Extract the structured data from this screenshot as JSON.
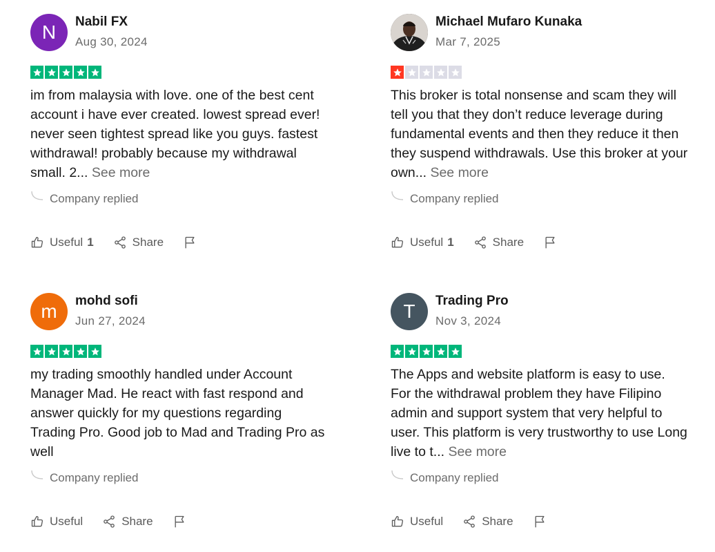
{
  "colors": {
    "star_filled": "#00b67a",
    "star_low": "#ff3722",
    "star_empty": "#dcdce6"
  },
  "actions": {
    "useful_label": "Useful",
    "share_label": "Share"
  },
  "reviews": [
    {
      "reviewer": "Nabil FX",
      "avatar_initial": "N",
      "avatar_color": "#7b25b6",
      "date": "Aug 30, 2024",
      "rating": 5,
      "text": "im from malaysia with love. one of the best cent account i have ever created. lowest spread ever! never seen tightest spread like you guys. fastest withdrawal! probably because my withdrawal small. 2...",
      "see_more": "See more",
      "company_replied": "Company replied",
      "useful_count": "1"
    },
    {
      "reviewer": "Michael Mufaro Kunaka",
      "avatar_initial": "",
      "avatar_color": "#3b3b3b",
      "date": "Mar 7, 2025",
      "rating": 1,
      "text": "This broker is total nonsense and scam they will tell you that they don’t reduce leverage during fundamental events and then they reduce it then they suspend withdrawals. Use this broker at your own...",
      "see_more": "See more",
      "company_replied": "Company replied",
      "useful_count": "1"
    },
    {
      "reviewer": "mohd sofi",
      "avatar_initial": "m",
      "avatar_color": "#ef6c0a",
      "date": "Jun 27, 2024",
      "rating": 5,
      "text": "my trading smoothly handled under Account Manager Mad. He react with fast respond and answer quickly for my questions regarding Trading Pro. Good job to Mad and Trading Pro as well",
      "see_more": "",
      "company_replied": "Company replied",
      "useful_count": ""
    },
    {
      "reviewer": "Trading Pro",
      "avatar_initial": "T",
      "avatar_color": "#455560",
      "date": "Nov 3, 2024",
      "rating": 5,
      "text": "The Apps and website platform is easy to use. For the withdrawal problem they have Filipino admin and support system that very helpful to user. This platform is very trustworthy to use Long live to t...",
      "see_more": "See more",
      "company_replied": "Company replied",
      "useful_count": ""
    }
  ]
}
